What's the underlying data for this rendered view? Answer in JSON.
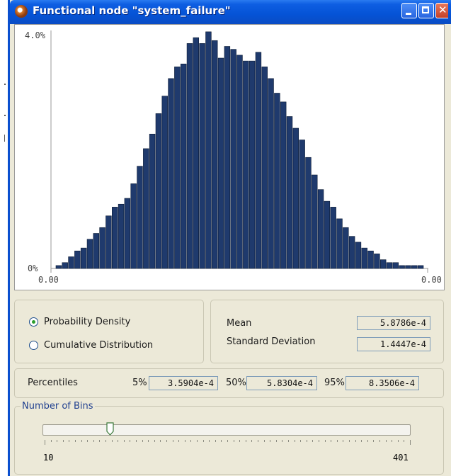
{
  "window": {
    "title": "Functional node \"system_failure\""
  },
  "chart": {
    "y_top_label": "4.0%",
    "y_bottom_label": "0%",
    "x_left_label": "0.00",
    "x_right_label": "0.00",
    "bar_color": "#1f3a6d"
  },
  "chart_data": {
    "type": "bar",
    "title": "",
    "xlabel": "",
    "ylabel": "",
    "ylim": [
      0,
      4.0
    ],
    "y_unit": "%",
    "values": [
      0.05,
      0.1,
      0.2,
      0.3,
      0.35,
      0.5,
      0.6,
      0.7,
      0.9,
      1.05,
      1.1,
      1.2,
      1.45,
      1.75,
      2.05,
      2.3,
      2.65,
      2.95,
      3.25,
      3.45,
      3.5,
      3.85,
      3.95,
      3.85,
      4.05,
      3.9,
      3.6,
      3.8,
      3.75,
      3.65,
      3.55,
      3.55,
      3.7,
      3.45,
      3.25,
      3.0,
      2.85,
      2.6,
      2.4,
      2.2,
      1.9,
      1.6,
      1.35,
      1.15,
      1.05,
      0.85,
      0.7,
      0.55,
      0.45,
      0.35,
      0.3,
      0.25,
      0.15,
      0.1,
      0.1,
      0.05,
      0.05,
      0.05,
      0.05
    ],
    "grid": false,
    "legend": "none"
  },
  "mode": {
    "option1": "Probability Density",
    "option2": "Cumulative Distribution",
    "selected": "Probability Density"
  },
  "stats": {
    "mean_label": "Mean",
    "mean_value": "5.8786e-4",
    "std_label": "Standard Deviation",
    "std_value": "1.4447e-4"
  },
  "percentiles": {
    "label": "Percentiles",
    "p5_label": "5%",
    "p5_value": "3.5904e-4",
    "p50_label": "50%",
    "p50_value": "5.8304e-4",
    "p95_label": "95%",
    "p95_value": "8.3506e-4"
  },
  "bins": {
    "group_label": "Number of Bins",
    "min_label": "10",
    "max_label": "401",
    "value_fraction": 0.18
  }
}
